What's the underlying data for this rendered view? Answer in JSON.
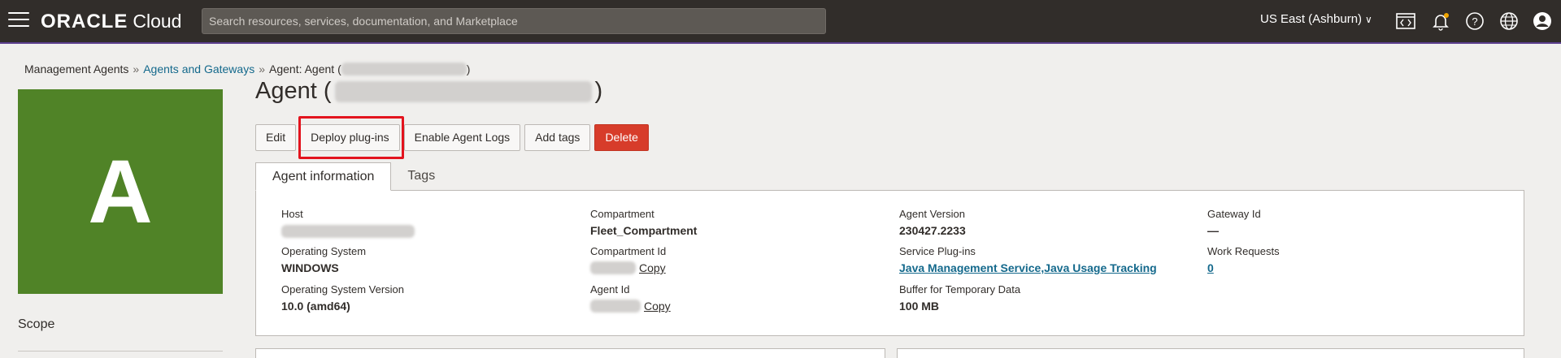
{
  "topbar": {
    "logo_brand": "ORACLE",
    "logo_product": "Cloud",
    "search_placeholder": "Search resources, services, documentation, and Marketplace",
    "region": "US East (Ashburn)"
  },
  "breadcrumb": {
    "root": "Management Agents",
    "parent": "Agents and Gateways",
    "current_prefix": "Agent: Agent (",
    "current_suffix": ")"
  },
  "avatar": {
    "letter": "A",
    "color": "#508327"
  },
  "sidebar": {
    "scope_label": "Scope"
  },
  "title": {
    "prefix": "Agent (",
    "suffix": ")"
  },
  "actions": {
    "edit": "Edit",
    "deploy_plugins": "Deploy plug-ins",
    "enable_logs": "Enable Agent Logs",
    "add_tags": "Add tags",
    "delete": "Delete"
  },
  "tabs": {
    "info": "Agent information",
    "tags": "Tags"
  },
  "info": {
    "host": {
      "label": "Host"
    },
    "os": {
      "label": "Operating System",
      "value": "WINDOWS"
    },
    "os_version": {
      "label": "Operating System Version",
      "value": "10.0 (amd64)"
    },
    "compartment": {
      "label": "Compartment",
      "value": "Fleet_Compartment"
    },
    "compartment_id": {
      "label": "Compartment Id",
      "copy": "Copy"
    },
    "agent_id": {
      "label": "Agent Id",
      "copy": "Copy"
    },
    "agent_version": {
      "label": "Agent Version",
      "value": "230427.2233"
    },
    "service_plugins": {
      "label": "Service Plug-ins",
      "value": "Java Management Service,Java Usage Tracking"
    },
    "buffer": {
      "label": "Buffer for Temporary Data",
      "value": "100 MB"
    },
    "gateway_id": {
      "label": "Gateway Id",
      "value": "—"
    },
    "work_requests": {
      "label": "Work Requests",
      "value": "0"
    }
  },
  "colors": {
    "topbar_bg": "#312d2a",
    "link": "#14698c",
    "danger": "#d73c2a",
    "highlight": "#e3141e"
  }
}
